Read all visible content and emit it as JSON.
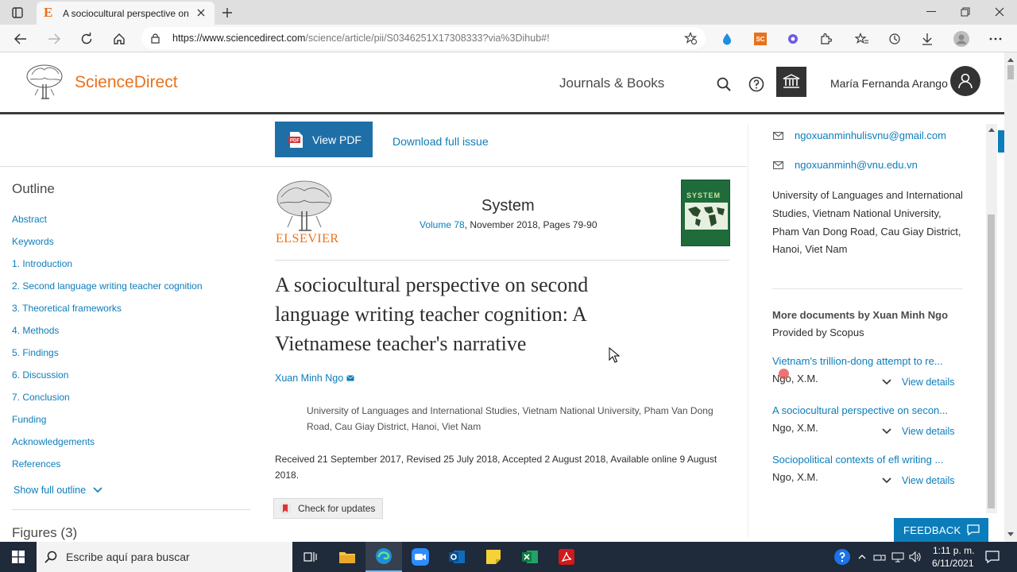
{
  "browser": {
    "tab_title": "A sociocultural perspective on se",
    "tab_favicon": "E",
    "url_host": "https://www.sciencedirect.com",
    "url_path": "/science/article/pii/S0346251X17308333?via%3Dihub#!",
    "ext_sc_label": "SC"
  },
  "header": {
    "logo_text": "ScienceDirect",
    "journals_books": "Journals & Books",
    "user_name": "María Fernanda Arango"
  },
  "toolbar": {
    "view_pdf": "View PDF",
    "download_issue": "Download full issue"
  },
  "outline": {
    "title": "Outline",
    "items": [
      "Abstract",
      "Keywords",
      "1. Introduction",
      "2. Second language writing teacher cognition",
      "3. Theoretical frameworks",
      "4. Methods",
      "5. Findings",
      "6. Discussion",
      "7. Conclusion",
      "Funding",
      "Acknowledgements",
      "References"
    ],
    "show_full": "Show full outline",
    "figures": "Figures (3)"
  },
  "article": {
    "publisher": "ELSEVIER",
    "journal": "System",
    "volume_link": "Volume 78",
    "volume_rest": ", November 2018, Pages 79-90",
    "title": "A sociocultural perspective on second language writing teacher cognition: A Vietnamese teacher's narrative",
    "author": "Xuan Minh Ngo",
    "affiliation": "University of Languages and International Studies, Vietnam National University, Pham Van Dong Road, Cau Giay District, Hanoi, Viet Nam",
    "dates": "Received 21 September 2017, Revised 25 July 2018, Accepted 2 August 2018, Available online 9 August 2018.",
    "check_updates": "Check for updates",
    "cover_label": "SYSTEM"
  },
  "right_panel": {
    "email1": "ngoxuanminhulisvnu@gmail.com",
    "email2": "ngoxuanminh@vnu.edu.vn",
    "affiliation": "University of Languages and International Studies, Vietnam National University, Pham Van Dong Road, Cau Giay District, Hanoi, Viet Nam",
    "more_docs": "More documents by Xuan Minh Ngo",
    "provided_by": "Provided by Scopus",
    "docs": [
      {
        "title": "Vietnam's trillion-dong attempt to re...",
        "author": "Ngo, X.M.",
        "action": "View details"
      },
      {
        "title": "A sociocultural perspective on secon...",
        "author": "Ngo, X.M.",
        "action": "View details"
      },
      {
        "title": "Sociopolitical contexts of efl writing ...",
        "author": "Ngo, X.M.",
        "action": "View details"
      }
    ],
    "feedback": "FEEDBACK"
  },
  "taskbar": {
    "search_placeholder": "Escribe aquí para buscar",
    "time": "1:11 p. m.",
    "date": "6/11/2021"
  },
  "colors": {
    "accent_blue": "#0c7dbb",
    "elsevier_orange": "#e9711c",
    "pdf_button": "#1e6fa8",
    "feedback": "#0c7dbb"
  }
}
